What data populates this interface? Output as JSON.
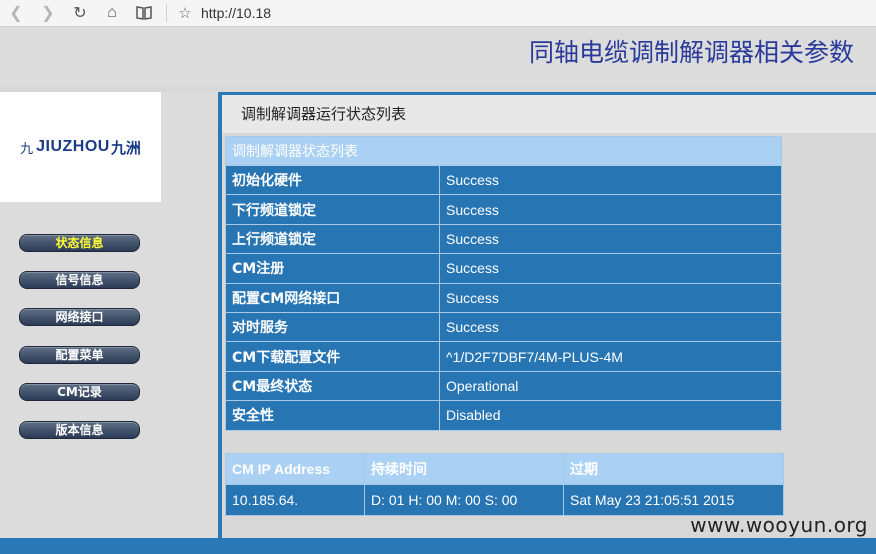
{
  "browser": {
    "url": "http://10.18",
    "back_icon": "arrow-left-icon",
    "forward_icon": "arrow-right-icon",
    "reload_icon": "reload-icon",
    "home_icon": "home-icon",
    "reader_icon": "book-icon",
    "star_icon": "star-icon"
  },
  "header": {
    "title": "同轴电缆调制解调器相关参数"
  },
  "logo": {
    "mark": "九",
    "text": "JIUZHOU",
    "cn": "九洲"
  },
  "menu": [
    {
      "label": "状态信息",
      "active": true
    },
    {
      "label": "信号信息"
    },
    {
      "label": "网络接口"
    },
    {
      "label": "配置菜单"
    },
    {
      "label": "CM记录"
    },
    {
      "label": "版本信息"
    }
  ],
  "page_heading": "调制解调器运行状态列表",
  "status_table": {
    "caption": "调制解调器状态列表",
    "rows": [
      {
        "label": "初始化硬件",
        "value": "Success"
      },
      {
        "label": "下行频道锁定",
        "value": "Success"
      },
      {
        "label": "上行频道锁定",
        "value": "Success"
      },
      {
        "label": "CM注册",
        "value": "Success"
      },
      {
        "label": "配置CM网络接口",
        "value": "Success"
      },
      {
        "label": "对时服务",
        "value": "Success"
      },
      {
        "label": "CM下载配置文件",
        "value": "^1/D2F7DBF7/4M-PLUS-4M"
      },
      {
        "label": "CM最终状态",
        "value": "Operational"
      },
      {
        "label": "安全性",
        "value": "Disabled"
      }
    ]
  },
  "cm_table": {
    "headers": [
      "CM IP Address",
      "持续时间",
      "过期"
    ],
    "row": [
      "10.185.64.",
      "D: 01 H: 00 M: 00 S: 00",
      "Sat May 23 21:05:51 2015"
    ]
  },
  "watermark": "www.wooyun.org",
  "colors": {
    "accent": "#2a78b5",
    "cell": "#2875b4",
    "header_cell": "#aad1f3",
    "title": "#2a3a9a"
  }
}
